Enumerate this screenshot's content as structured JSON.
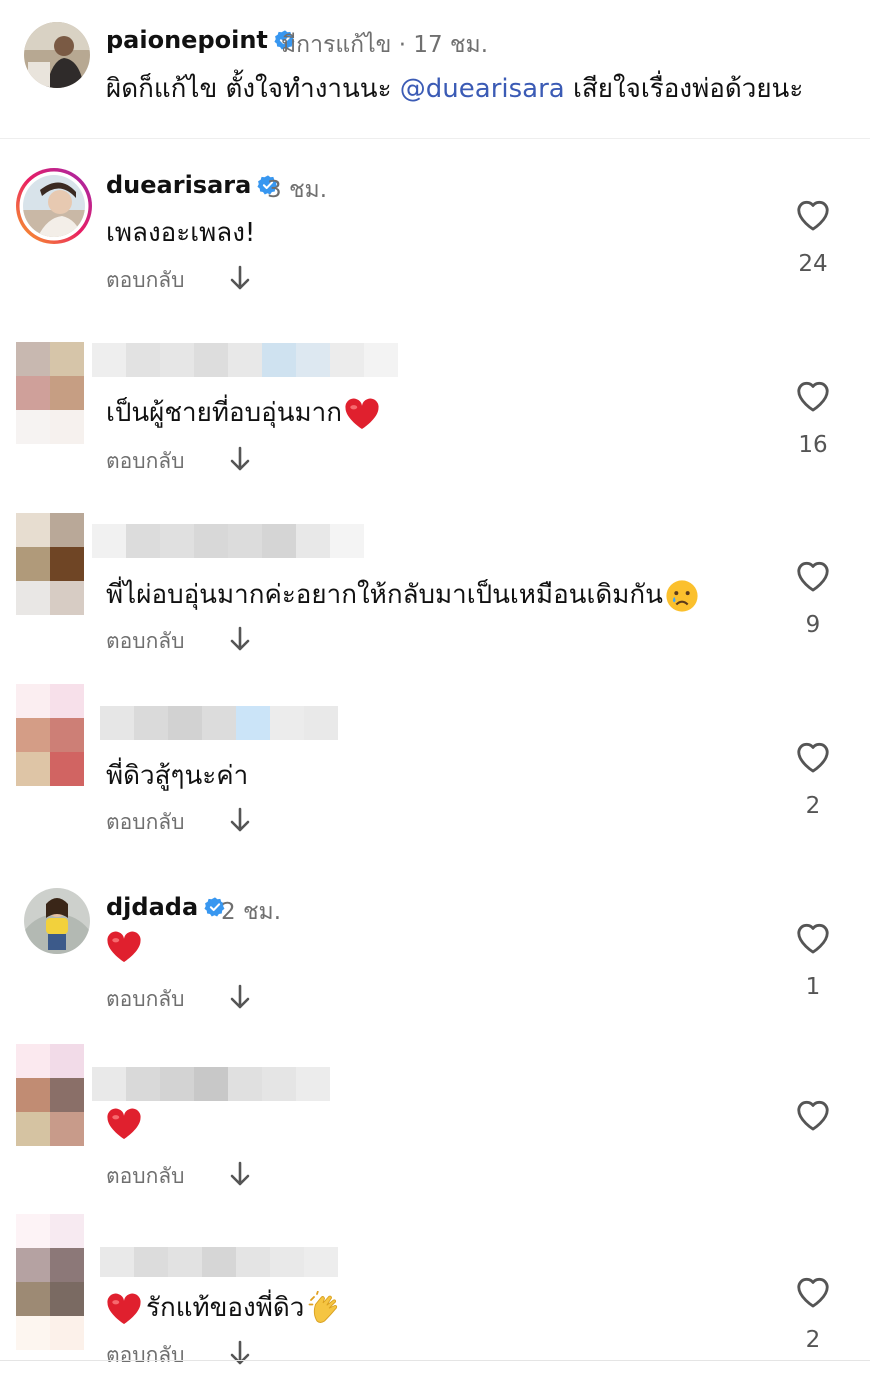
{
  "caption": {
    "username": "paionepoint",
    "edited": "มีการแก้ไข",
    "dot": "·",
    "time": "17 ชม.",
    "text_before": "ผิดก็แก้ไข ตั้งใจทำงานนะ ",
    "mention": "@duearisara",
    "text_after": "  เสียใจเรื่องพ่อด้วยนะ"
  },
  "reply_label": "ตอบกลับ",
  "comments": [
    {
      "username": "duearisara",
      "time": "3 ชม.",
      "text": "เพลงอะเพลง!",
      "likes": "24"
    },
    {
      "username": "",
      "text": "เป็นผู้ชายที่อบอุ่นมาก",
      "likes": "16",
      "emoji": "red-heart"
    },
    {
      "username": "",
      "text": "พี่ไผ่อบอุ่นมากค่ะอยากให้กลับมาเป็นเหมือนเดิมกัน",
      "likes": "9",
      "emoji": "crying-face"
    },
    {
      "username": "",
      "text": "พี่ดิวสู้ๆนะค่า",
      "likes": "2"
    },
    {
      "username": "djdada",
      "time": "2 ชม.",
      "text": "",
      "likes": "1",
      "emoji": "red-heart"
    },
    {
      "username": "",
      "text": "",
      "likes": "",
      "emoji": "red-heart"
    },
    {
      "username": "",
      "text": "รักแท้ของพี่ดิว",
      "likes": "2",
      "emoji": "red-heart, clapping-hands"
    }
  ],
  "colors": {
    "mention": "#3b5bb5",
    "verified": "#3897f0",
    "heart_emoji": "#e0202e",
    "muted": "#6f6f6f"
  }
}
